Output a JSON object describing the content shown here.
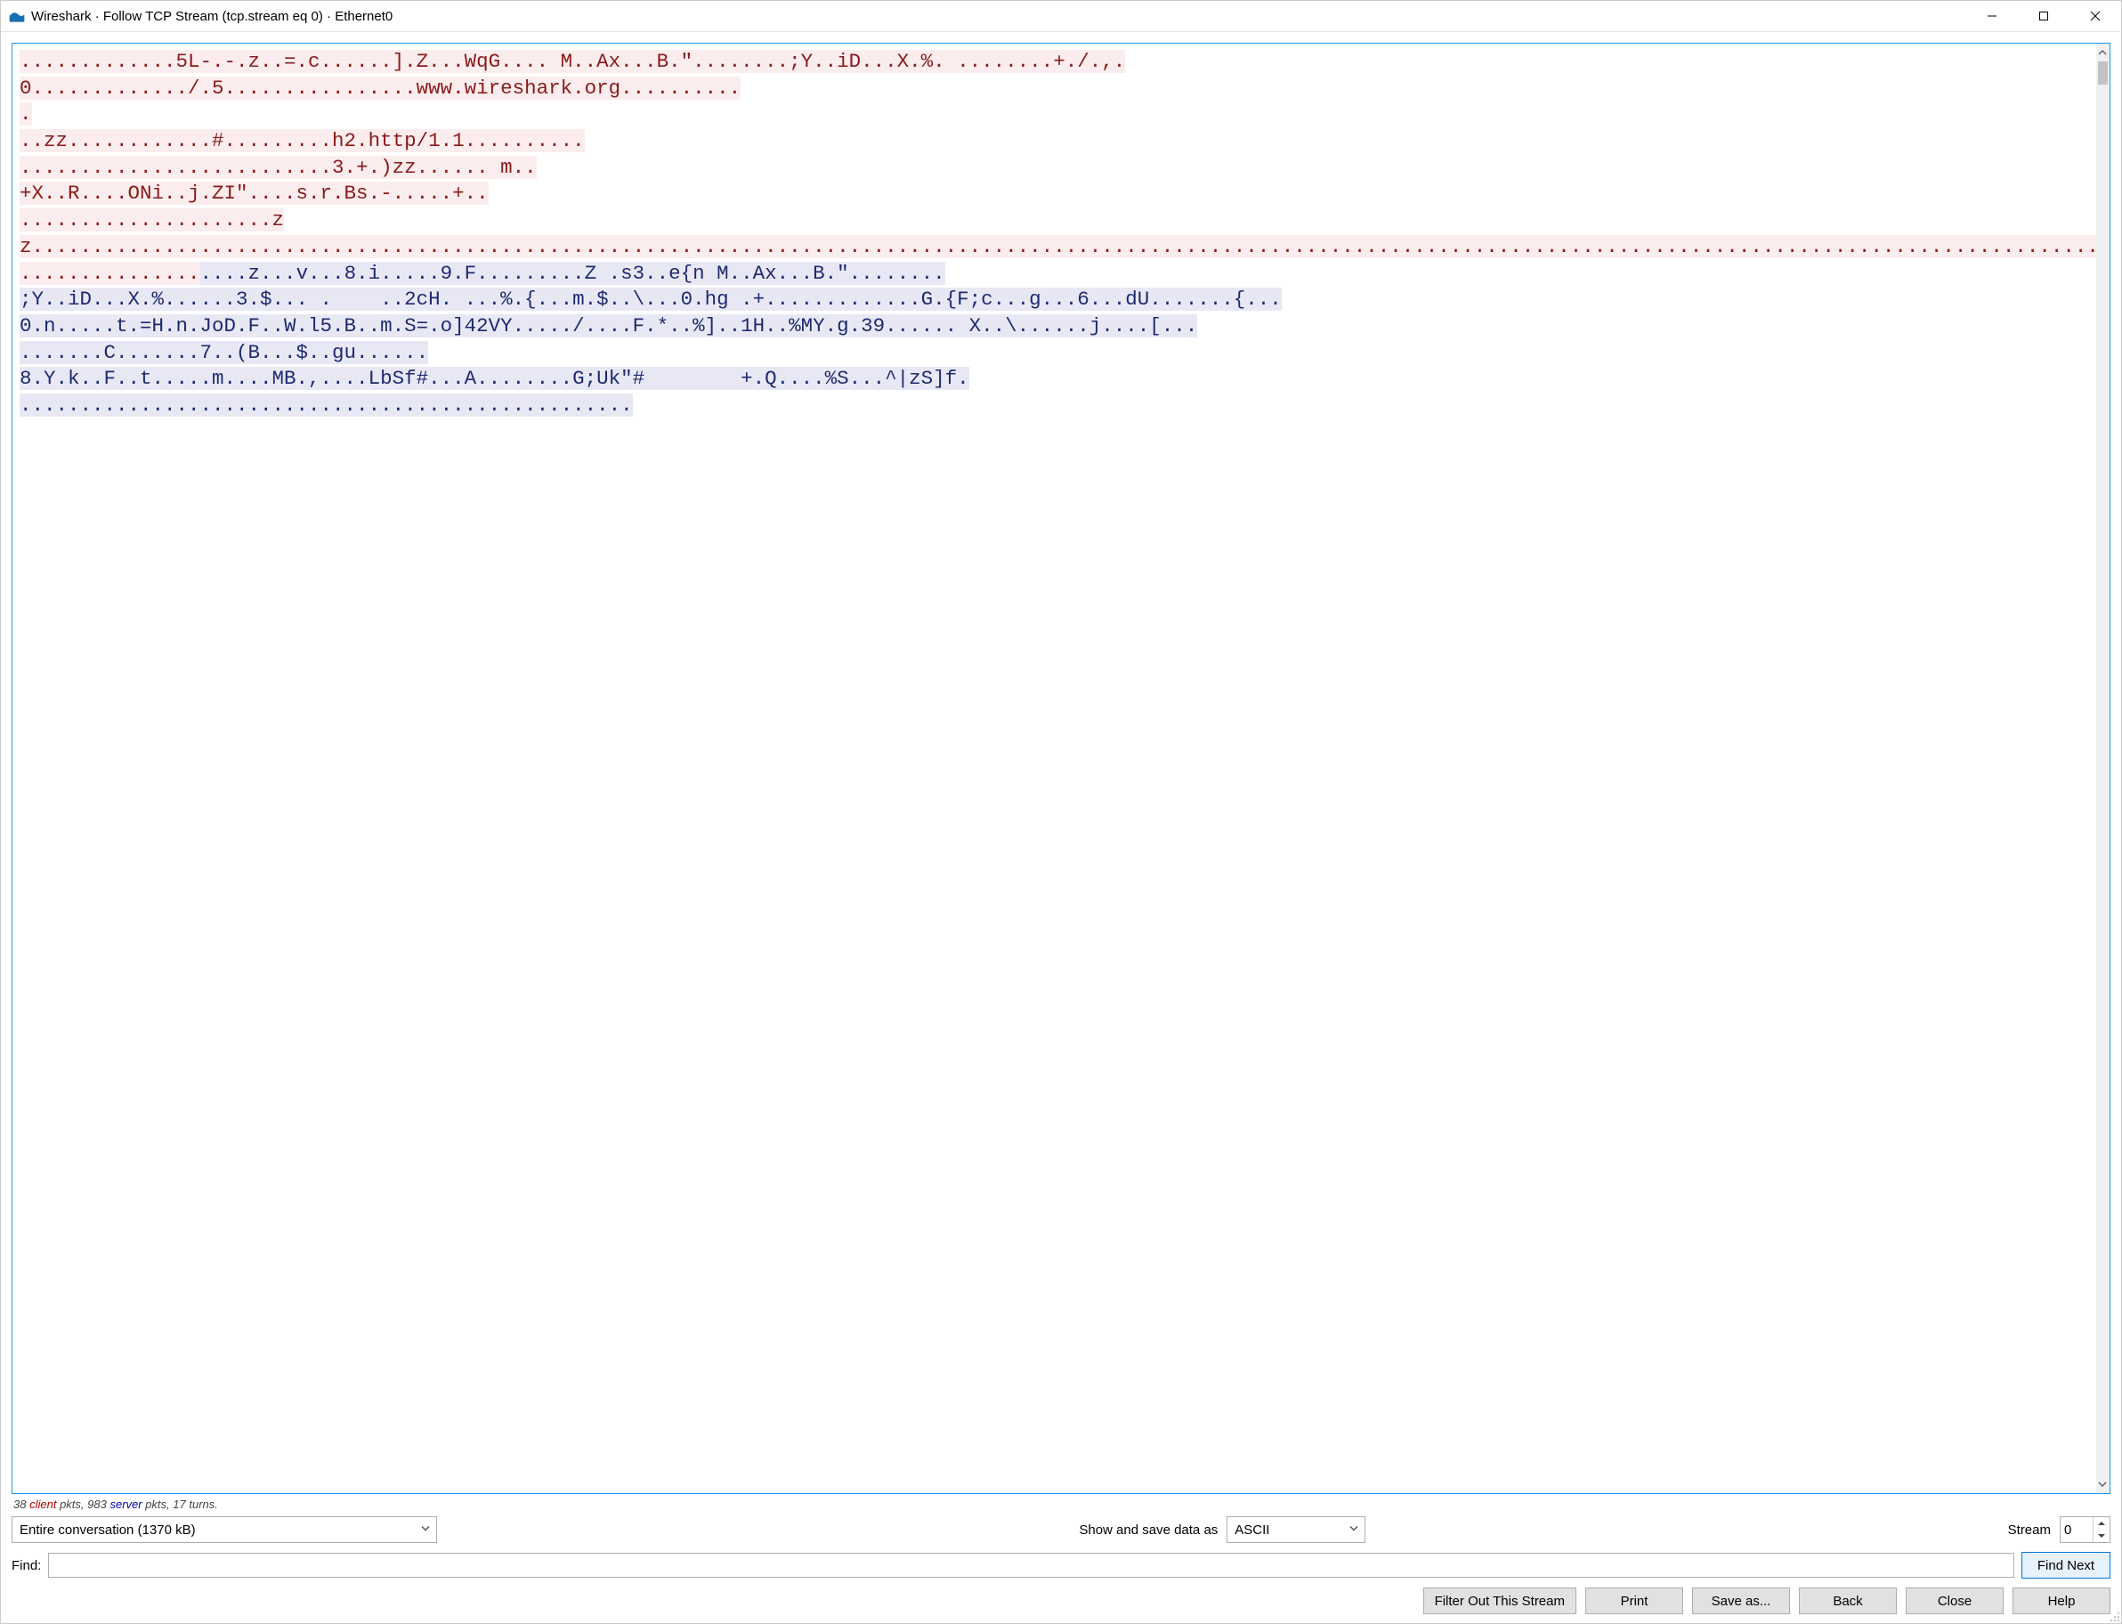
{
  "titlebar": {
    "title": "Wireshark · Follow TCP Stream (tcp.stream eq 0) · Ethernet0"
  },
  "stream": {
    "segments": [
      {
        "side": "client",
        "text": ".............5L-.-.z..=.c......].Z...WqG.... M..Ax...B.\"........;Y..iD...X.%. ........+./.,."
      },
      {
        "side": "plain",
        "text": "\n"
      },
      {
        "side": "client",
        "text": "0............./.5................www.wireshark.org.........."
      },
      {
        "side": "plain",
        "text": "\n"
      },
      {
        "side": "client",
        "text": "."
      },
      {
        "side": "plain",
        "text": "\n"
      },
      {
        "side": "client",
        "text": "..zz............#.........h2.http/1.1.........."
      },
      {
        "side": "plain",
        "text": "\n"
      },
      {
        "side": "client",
        "text": "..........................3.+.)zz...... m.."
      },
      {
        "side": "plain",
        "text": "\n"
      },
      {
        "side": "client",
        "text": "+X..R....ONi..j.ZI\"....s.r.Bs.-.....+.."
      },
      {
        "side": "plain",
        "text": "\n"
      },
      {
        "side": "client",
        "text": ".....................zz........................................................................................................................................................................................................"
      },
      {
        "side": "plain",
        "text": "\n"
      },
      {
        "side": "client",
        "text": "..............."
      },
      {
        "side": "server",
        "text": "....z...v...8.i.....9.F.........Z .s3..e{n M..Ax...B.\"........"
      },
      {
        "side": "plain",
        "text": "\n"
      },
      {
        "side": "server",
        "text": ";Y..iD...X.%......3.$... .    ..2cH. ...%.{...m.$..\\...0.hg .+.............G.{F;c...g...6...dU.......{..."
      },
      {
        "side": "plain",
        "text": "\n"
      },
      {
        "side": "server",
        "text": "0.n.....t.=H.n.JoD.F..W.l5.B..m.S=.o]42VY...../....F.*..%]..1H..%MY.g.39...... X..\\......j....[..."
      },
      {
        "side": "plain",
        "text": "\n"
      },
      {
        "side": "server",
        "text": ".......C.......7..(B...$..gu......"
      },
      {
        "side": "plain",
        "text": "\n"
      },
      {
        "side": "server",
        "text": "8.Y.k..F..t.....m....MB.,....LbSf#...A........G;Uk\"#        +.Q....%S...^|zS]f."
      },
      {
        "side": "plain",
        "text": "\n"
      },
      {
        "side": "server",
        "text": "..................................................."
      }
    ]
  },
  "stats": {
    "client_pkts": 38,
    "server_pkts": 983,
    "turns": 17,
    "tpl_a": " ",
    "tpl_client": "client",
    "tpl_b": " pkts, ",
    "tpl_server": "server",
    "tpl_c": " pkts, ",
    "tpl_d": " turns."
  },
  "options": {
    "conversation_selected": "Entire conversation (1370 kB)",
    "show_save_label": "Show and save data as",
    "format_selected": "ASCII",
    "stream_label": "Stream",
    "stream_value": "0"
  },
  "find": {
    "label": "Find:",
    "value": "",
    "button": "Find Next"
  },
  "buttons": {
    "filter_out": "Filter Out This Stream",
    "print": "Print",
    "save_as": "Save as...",
    "back": "Back",
    "close": "Close",
    "help": "Help"
  }
}
